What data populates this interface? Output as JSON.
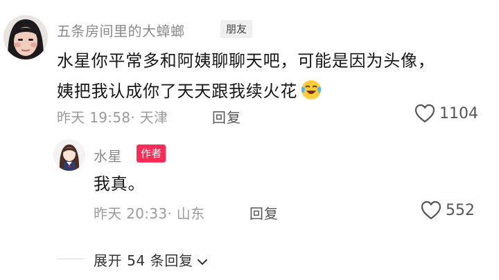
{
  "comment": {
    "username": "五条房间里的大蟑螂",
    "badge": "朋友",
    "text_line1": "水星你平常多和阿姨聊聊天吧，可能是因为头像，",
    "text_line2": "姨把我认成你了天天跟我续火花",
    "emoji": "laughing-crying-emoji",
    "time": "昨天 19:58",
    "location": "· 天津",
    "reply_label": "回复",
    "likes": "1104"
  },
  "reply": {
    "username": "水星",
    "badge": "作者",
    "text": "我真。",
    "time": "昨天 20:33",
    "location": "· 山东",
    "reply_label": "回复",
    "likes": "552"
  },
  "expand": {
    "label": "展开 54 条回复"
  },
  "colors": {
    "author_badge": "#fe2c55",
    "muted_text": "#9a9a9a"
  }
}
